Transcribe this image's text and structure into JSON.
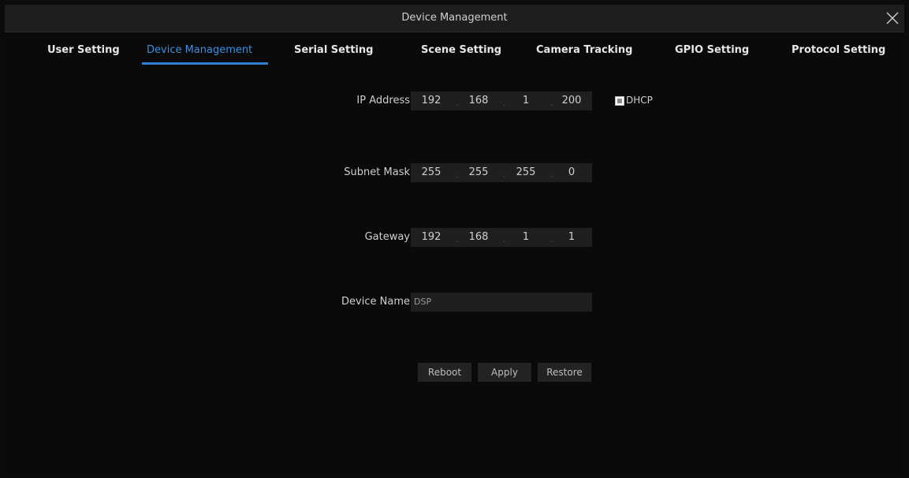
{
  "window": {
    "title": "Device Management"
  },
  "tabs": [
    {
      "label": "User Setting"
    },
    {
      "label": "Device Management"
    },
    {
      "label": "Serial Setting"
    },
    {
      "label": "Scene Setting"
    },
    {
      "label": "Camera Tracking"
    },
    {
      "label": "GPIO Setting"
    },
    {
      "label": "Protocol Setting"
    }
  ],
  "active_tab": "Device Management",
  "form": {
    "ip_address": {
      "label": "IP Address",
      "octets": [
        "192",
        "168",
        "1",
        "200"
      ]
    },
    "dhcp": {
      "label": "DHCP",
      "checked": true
    },
    "subnet_mask": {
      "label": "Subnet Mask",
      "octets": [
        "255",
        "255",
        "255",
        "0"
      ]
    },
    "gateway": {
      "label": "Gateway",
      "octets": [
        "192",
        "168",
        "1",
        "1"
      ]
    },
    "device_name": {
      "label": "Device Name",
      "value": "DSP"
    }
  },
  "buttons": {
    "reboot": "Reboot",
    "apply": "Apply",
    "restore": "Restore"
  },
  "colors": {
    "accent": "#2f7fd3",
    "background": "#0a0a0a",
    "field": "#1f1f1f"
  },
  "icons": {
    "close": "close-icon"
  }
}
